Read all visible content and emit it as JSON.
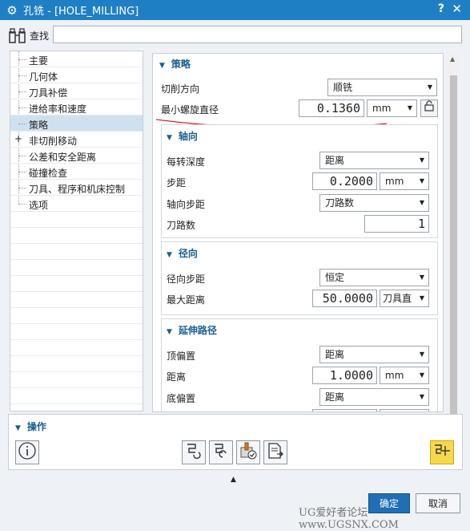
{
  "window": {
    "title": "孔铣 - [HOLE_MILLING]",
    "help": "?",
    "close": "✕"
  },
  "search": {
    "label": "查找",
    "value": ""
  },
  "tree": {
    "items": [
      {
        "label": "主要"
      },
      {
        "label": "几何体"
      },
      {
        "label": "刀具补偿"
      },
      {
        "label": "进给率和速度"
      },
      {
        "label": "策略"
      },
      {
        "label": "非切削移动"
      },
      {
        "label": "公差和安全距离"
      },
      {
        "label": "碰撞检查"
      },
      {
        "label": "刀具、程序和机床控制"
      },
      {
        "label": "选项"
      }
    ],
    "expand_symbol": "+"
  },
  "strategy": {
    "header": "策略",
    "cut_direction_label": "切削方向",
    "cut_direction_value": "顺铣",
    "min_helix_label": "最小螺旋直径",
    "min_helix_value": "0.1360",
    "min_helix_unit": "mm"
  },
  "axial": {
    "header": "轴向",
    "depth_per_rev_label": "每转深度",
    "depth_per_rev_value": "距离",
    "step_label": "步距",
    "step_value": "0.2000",
    "step_unit": "mm",
    "axial_step_label": "轴向步距",
    "axial_step_value": "刀路数",
    "passes_label": "刀路数",
    "passes_value": "1"
  },
  "radial": {
    "header": "径向",
    "radial_step_label": "径向步距",
    "radial_step_value": "恒定",
    "max_distance_label": "最大距离",
    "max_distance_value": "50.0000",
    "max_distance_unit": "刀具直"
  },
  "extend": {
    "header": "延伸路径",
    "top_offset_label": "顶偏置",
    "top_offset_value": "距离",
    "distance_label": "距离",
    "distance_value": "1.0000",
    "distance_unit": "mm",
    "bottom_offset_label": "底偏置",
    "bottom_offset_value": "距离"
  },
  "operations": {
    "header": "操作"
  },
  "buttons": {
    "ok": "确定",
    "cancel": "取消"
  },
  "watermark": "UG爱好者论坛 www.UGSNX.COM",
  "colors": {
    "titlebar": "#1f7fc4",
    "accent": "#1a5d8f",
    "highlight": "#f6d84f",
    "annotation": "#e0202a"
  }
}
